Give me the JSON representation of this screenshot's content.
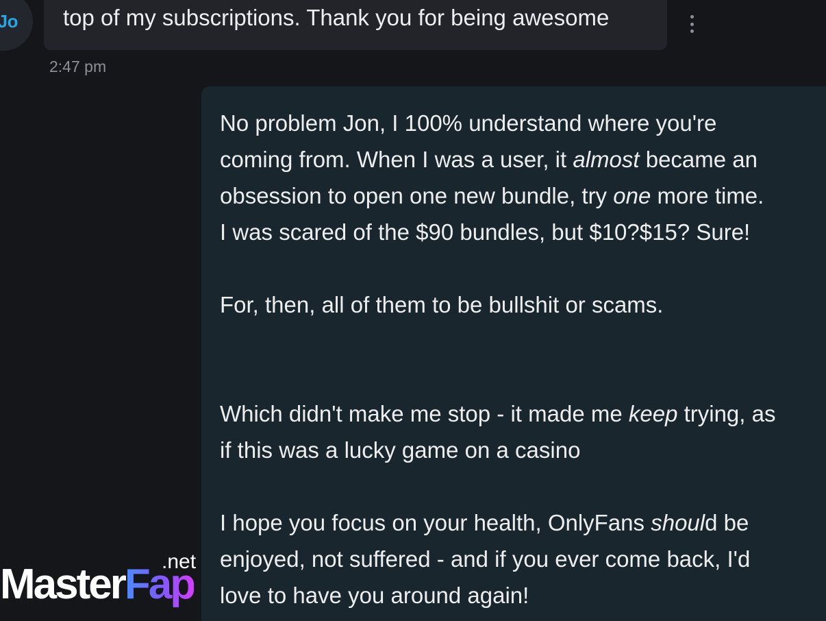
{
  "contact": {
    "avatar_initials": "Jo"
  },
  "incoming_message": {
    "text": "top of my subscriptions. Thank you for being awesome",
    "timestamp": "2:47 pm"
  },
  "more_menu": {
    "icon": "more-vertical-icon"
  },
  "outgoing_message": {
    "paragraphs": [
      {
        "lines": [
          [
            {
              "text": "No problem Jon, I 100% understand where you're"
            }
          ],
          [
            {
              "text": "coming from. When I was a user, it "
            },
            {
              "text": "almost",
              "italic": true
            },
            {
              "text": " became an"
            }
          ],
          [
            {
              "text": "obsession to open one new bundle, try "
            },
            {
              "text": "one",
              "italic": true
            },
            {
              "text": " more time."
            }
          ],
          [
            {
              "text": "I was scared of the $90 bundles, but $10?$15? Sure!"
            }
          ]
        ]
      },
      {
        "lines": [
          [
            {
              "text": "For, then, all of them to be bullshit or scams."
            }
          ]
        ]
      },
      {
        "lines": [
          [
            {
              "text": "Which didn't make me stop - it made me "
            },
            {
              "text": "keep",
              "italic": true
            },
            {
              "text": " trying, as"
            }
          ],
          [
            {
              "text": "if this was a lucky game on a casino"
            }
          ]
        ]
      },
      {
        "lines": [
          [
            {
              "text": "I hope you focus on your health, OnlyFans "
            },
            {
              "text": "shoul",
              "italic": true
            },
            {
              "text": "d be"
            }
          ],
          [
            {
              "text": "enjoyed, not suffered - and if you ever come back, I'd"
            }
          ],
          [
            {
              "text": "love to have you around again!"
            }
          ]
        ]
      }
    ]
  },
  "watermark": {
    "part1": "Master",
    "part2": "Fap",
    "tld": ".net"
  },
  "colors": {
    "background": "#151619",
    "incoming_bubble": "#222429",
    "outgoing_bubble": "#1a262d",
    "avatar_text": "#2aa4e4",
    "timestamp": "#8b8f96"
  }
}
